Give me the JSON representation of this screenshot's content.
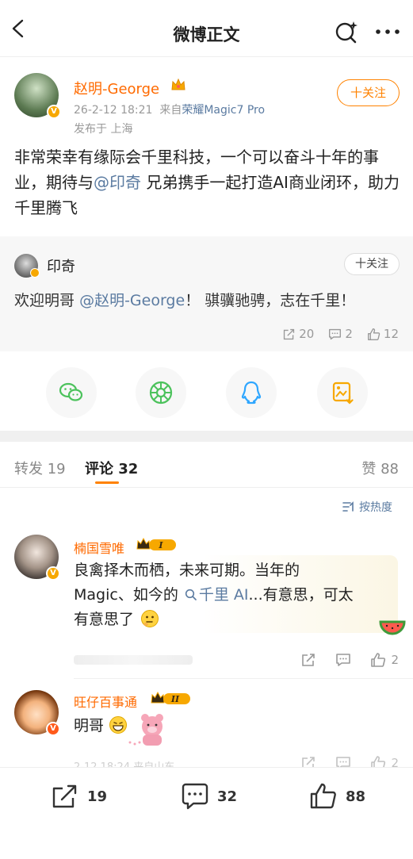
{
  "nav": {
    "title": "微博正文",
    "back_icon": "chevron-left-icon",
    "search_icon": "search-sparkle-icon",
    "more_icon": "more-dots-icon"
  },
  "post": {
    "author": "赵明-George",
    "time": "26-2-12 18:21",
    "from_prefix": "来自",
    "source": "荣耀Magic7 Pro",
    "location": "发布于 上海",
    "follow_label": "十关注",
    "content_parts": {
      "p1": "非常荣幸有缘际会千里科技，一个可以奋斗十年的事业，期待与",
      "mention": "@印奇",
      "p2": "兄弟携手一起打造AI商业闭环，助力千里腾飞"
    }
  },
  "repost": {
    "name": "印奇",
    "follow_label": "十关注",
    "text_before": "欢迎明哥",
    "mention": "@赵明-George",
    "text_after": "！ 骐骥驰骋，志在千里！",
    "reposts": "20",
    "comments": "2",
    "likes": "12"
  },
  "share": {
    "items": [
      "wechat-icon",
      "moments-icon",
      "qq-icon",
      "save-image-icon"
    ]
  },
  "tabs": {
    "repost": "转发 19",
    "comment": "评论 32",
    "like": "赞 88"
  },
  "sort_label": "按热度",
  "comments": [
    {
      "name": "楠国雪唯",
      "level": "I",
      "text_line1": "良禽择木而栖，未来可期。当年的",
      "text_line2_before": "Magic、如今的",
      "search_kw": "千里 AI",
      "text_line2_after": "...有意思，可太",
      "text_line3": "有意思了",
      "likes": "2"
    },
    {
      "name": "旺仔百事通",
      "level": "II",
      "text": "明哥",
      "meta": "2-12 18:24 来自山东",
      "likes": "2"
    }
  ],
  "bottom": {
    "reposts": "19",
    "comments": "32",
    "likes": "88"
  },
  "colors": {
    "accent": "#ff8200",
    "name_orange": "#ff6a00",
    "link_blue": "#5b7ba1",
    "vip_gold": "#f7a800",
    "muted": "#999999"
  }
}
